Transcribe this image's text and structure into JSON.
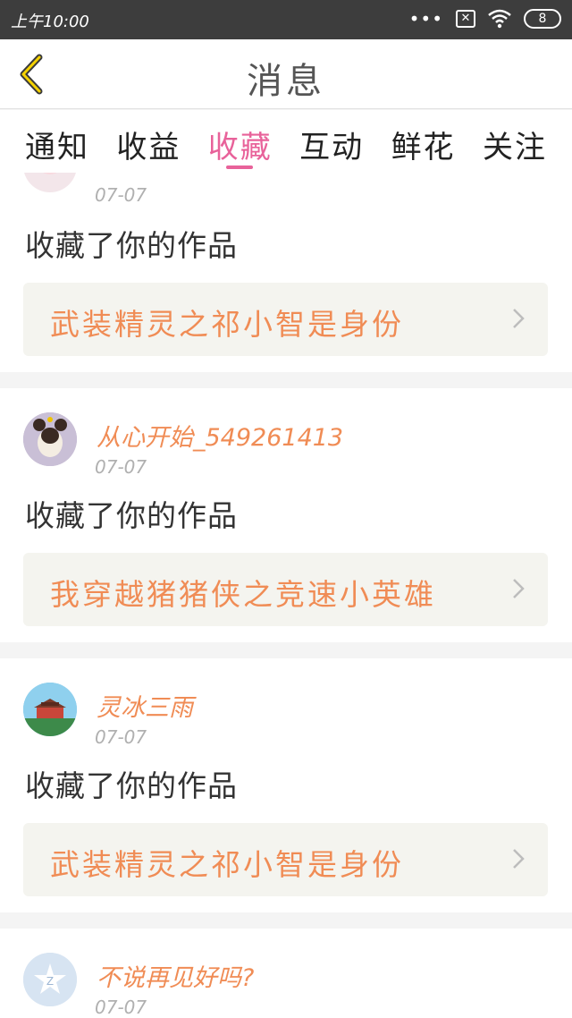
{
  "status_bar": {
    "time": "上午10:00",
    "dots": "•••",
    "sim": "✕",
    "battery": "8"
  },
  "header": {
    "title": "消息"
  },
  "tabs": [
    {
      "label": "通知"
    },
    {
      "label": "收益"
    },
    {
      "label": "收藏",
      "active": true
    },
    {
      "label": "互动"
    },
    {
      "label": "鲜花"
    },
    {
      "label": "关注"
    }
  ],
  "messages": [
    {
      "user": "",
      "date": "07-07",
      "action": "收藏了你的作品",
      "work": "武装精灵之祁小智是身份"
    },
    {
      "user": "从心开始_549261413",
      "date": "07-07",
      "action": "收藏了你的作品",
      "work": "我穿越猪猪侠之竞速小英雄"
    },
    {
      "user": "灵冰三雨",
      "date": "07-07",
      "action": "收藏了你的作品",
      "work": "武装精灵之祁小智是身份"
    },
    {
      "user": "不说再见好吗?",
      "date": "07-07"
    }
  ],
  "colors": {
    "accent_pink": "#e8629a",
    "username_orange": "#f08c55",
    "status_bar": "#3d3d3d"
  }
}
